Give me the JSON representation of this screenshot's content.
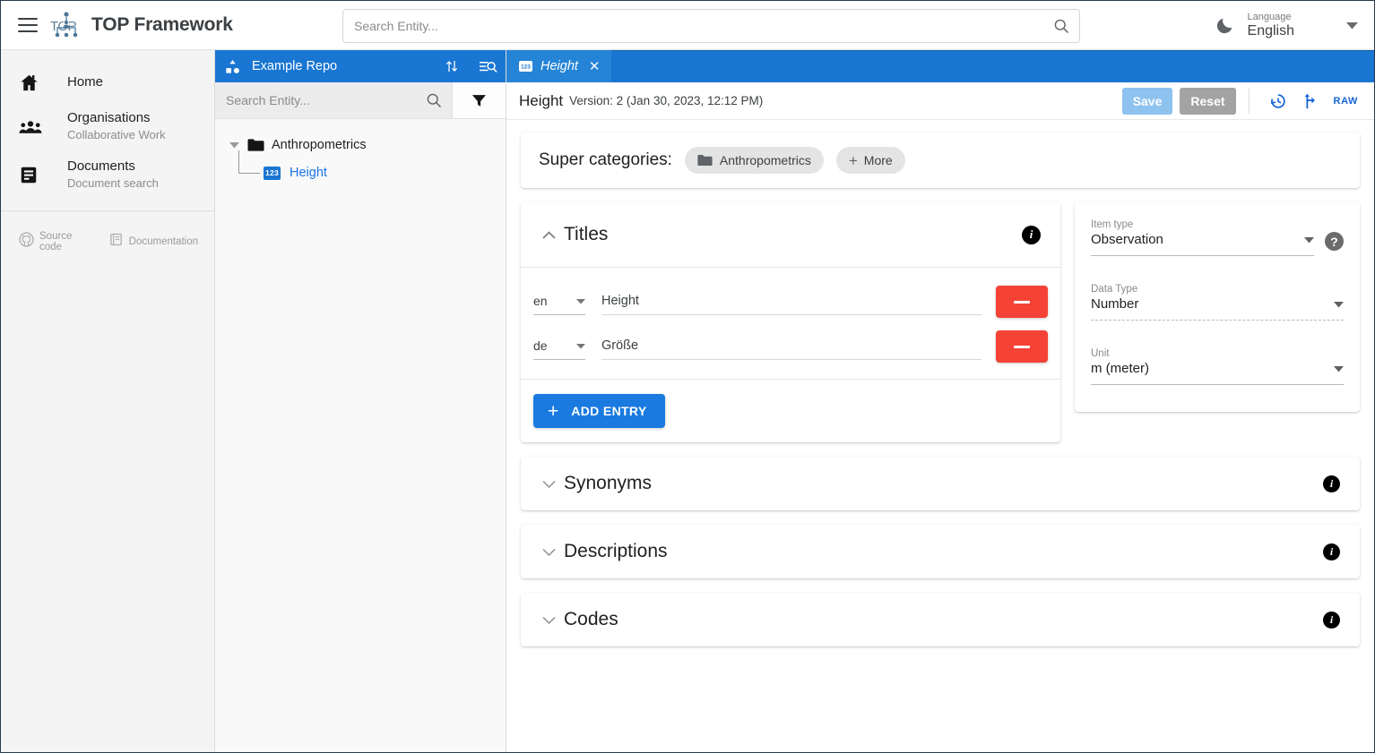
{
  "header": {
    "menu_icon": "hamburger-menu-icon",
    "logo_icon": "top-network-logo-icon",
    "brand_title": "TOP Framework",
    "search": {
      "placeholder": "Search Entity...",
      "value": "",
      "icon": "search-icon"
    },
    "theme_toggle_icon": "dark-mode-moon-icon",
    "language": {
      "label": "Language",
      "value": "English",
      "caret_icon": "chevron-down-icon"
    }
  },
  "sidebar": {
    "items": [
      {
        "icon": "home-icon",
        "title": "Home",
        "subtitle": ""
      },
      {
        "icon": "people-group-icon",
        "title": "Organisations",
        "subtitle": "Collaborative Work"
      },
      {
        "icon": "document-icon",
        "title": "Documents",
        "subtitle": "Document search"
      }
    ],
    "footer": [
      {
        "icon": "github-icon",
        "label": "Source code"
      },
      {
        "icon": "book-documentation-icon",
        "label": "Documentation"
      }
    ]
  },
  "repo_panel": {
    "icon": "repository-icon",
    "name": "Example Repo",
    "sort_icon": "sort-arrows-icon",
    "manage_search_icon": "manage-search-icon",
    "search": {
      "placeholder": "Search Entity...",
      "value": "",
      "icon": "search-icon"
    },
    "filter_icon": "filter-funnel-icon",
    "tree": [
      {
        "type": "category",
        "icon": "folder-icon",
        "label": "Anthropometrics",
        "expanded": true,
        "toggle_icon": "caret-down-icon",
        "children": [
          {
            "type": "entity",
            "icon": "number-123-badge-icon",
            "badge": "123",
            "label": "Height"
          }
        ]
      }
    ]
  },
  "tabs": [
    {
      "icon": "number-123-badge-icon",
      "label": "Height",
      "close_icon": "close-x-icon",
      "active": true
    }
  ],
  "toolbar": {
    "title": "Height",
    "version_text": "Version: 2 (Jan 30, 2023, 12:12 PM)",
    "save_label": "Save",
    "reset_label": "Reset",
    "history_icon": "history-restore-icon",
    "fork_icon": "fork-branch-icon",
    "raw_label": "RAW"
  },
  "super_categories": {
    "label": "Super categories:",
    "chips": [
      {
        "icon": "folder-icon",
        "label": "Anthropometrics"
      },
      {
        "icon": "plus-icon",
        "label": "More"
      }
    ]
  },
  "titles_section": {
    "toggle_icon": "chevron-up-icon",
    "title": "Titles",
    "info_icon": "info-circle-icon",
    "entries": [
      {
        "lang": "en",
        "lang_caret_icon": "chevron-down-icon",
        "text": "Height",
        "remove_icon": "minus-icon"
      },
      {
        "lang": "de",
        "lang_caret_icon": "chevron-down-icon",
        "text": "Größe",
        "remove_icon": "minus-icon"
      }
    ],
    "add_entry_label": "ADD ENTRY",
    "add_entry_icon": "plus-icon"
  },
  "properties": {
    "help_icon": "help-circle-icon",
    "fields": [
      {
        "label": "Item type",
        "value": "Observation",
        "caret_icon": "chevron-down-icon",
        "underline": "solid"
      },
      {
        "label": "Data Type",
        "value": "Number",
        "caret_icon": "chevron-down-icon",
        "underline": "dashed"
      },
      {
        "label": "Unit",
        "value": "m (meter)",
        "caret_icon": "chevron-down-icon",
        "underline": "solid"
      }
    ]
  },
  "collapsed_sections": [
    {
      "toggle_icon": "chevron-down-icon",
      "title": "Synonyms",
      "info_icon": "info-circle-icon"
    },
    {
      "toggle_icon": "chevron-down-icon",
      "title": "Descriptions",
      "info_icon": "info-circle-icon"
    },
    {
      "toggle_icon": "chevron-down-icon",
      "title": "Codes",
      "info_icon": "info-circle-icon"
    }
  ],
  "colors": {
    "primary_blue": "#1976d2",
    "tab_blue": "#2684d6",
    "accent_link": "#1a73e8",
    "danger_red": "#f44336",
    "save_blue": "#8ec2ef",
    "reset_gray": "#a3a3a3",
    "sidebar_bg": "#f4f4f4",
    "repo_bg": "#f9f9f9"
  }
}
